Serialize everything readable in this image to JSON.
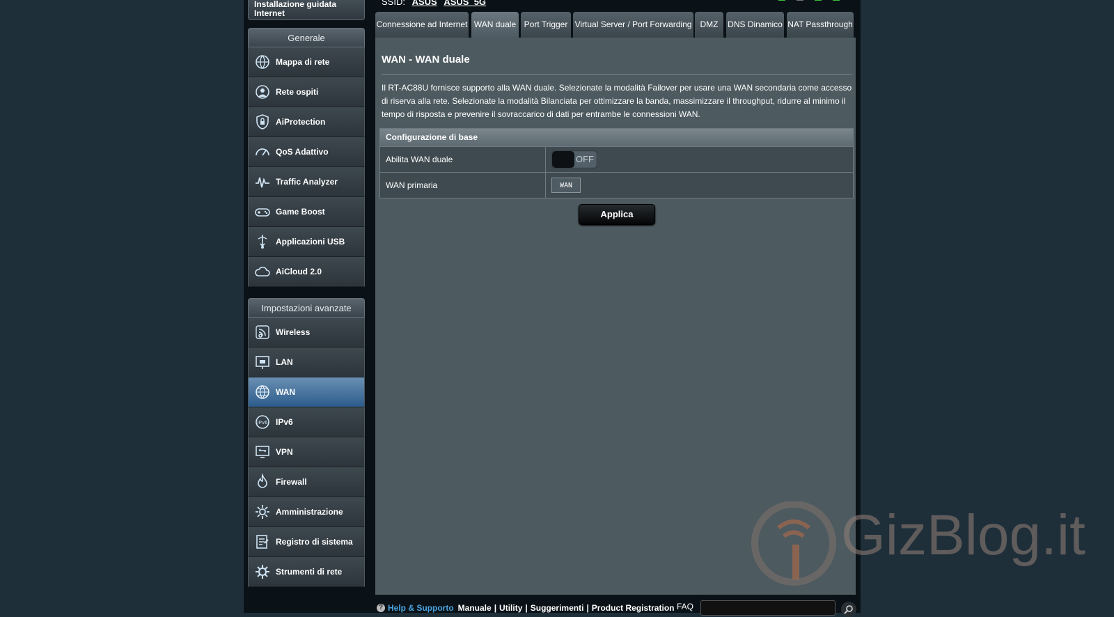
{
  "header": {
    "ssid_label": "SSID:",
    "ssid_1": "ASUS",
    "ssid_2": "ASUS_5G"
  },
  "sidebar": {
    "quick_setup": "Installazione guidata Internet",
    "general_title": "Generale",
    "general_items": [
      {
        "label": "Mappa di rete",
        "icon": "network-map-icon"
      },
      {
        "label": "Rete ospiti",
        "icon": "guest-network-icon"
      },
      {
        "label": "AiProtection",
        "icon": "shield-lock-icon"
      },
      {
        "label": "QoS Adattivo",
        "icon": "gauge-icon"
      },
      {
        "label": "Traffic Analyzer",
        "icon": "traffic-graph-icon"
      },
      {
        "label": "Game Boost",
        "icon": "gamepad-icon"
      },
      {
        "label": "Applicazioni USB",
        "icon": "usb-icon"
      },
      {
        "label": "AiCloud 2.0",
        "icon": "cloud-icon"
      }
    ],
    "advanced_title": "Impostazioni avanzate",
    "advanced_items": [
      {
        "label": "Wireless",
        "icon": "wireless-icon"
      },
      {
        "label": "LAN",
        "icon": "lan-icon"
      },
      {
        "label": "WAN",
        "icon": "globe-icon",
        "active": true
      },
      {
        "label": "IPv6",
        "icon": "ipv6-icon"
      },
      {
        "label": "VPN",
        "icon": "vpn-icon"
      },
      {
        "label": "Firewall",
        "icon": "fire-icon"
      },
      {
        "label": "Amministrazione",
        "icon": "admin-gear-icon"
      },
      {
        "label": "Registro di sistema",
        "icon": "log-icon"
      },
      {
        "label": "Strumenti di rete",
        "icon": "tools-gear-icon"
      }
    ]
  },
  "tabs": [
    {
      "label": "Connessione ad Internet"
    },
    {
      "label": "WAN duale",
      "active": true
    },
    {
      "label": "Port Trigger"
    },
    {
      "label": "Virtual Server / Port Forwarding"
    },
    {
      "label": "DMZ"
    },
    {
      "label": "DNS Dinamico"
    },
    {
      "label": "NAT Passthrough"
    }
  ],
  "main": {
    "title": "WAN - WAN duale",
    "description": "Il RT-AC88U fornisce supporto alla WAN duale. Selezionate la modalità Failover per usare una WAN secondaria come accesso di riserva alla rete. Selezionate la modalità Bilanciata per ottimizzare la banda, massimizzare il throughput, ridurre al minimo il tempo di risposta e prevenire il sovraccarico di dati per entrambe le connessioni WAN.",
    "config": {
      "header": "Configurazione di base",
      "enable_label": "Abilita WAN duale",
      "enable_state": "OFF",
      "primary_label": "WAN primaria",
      "primary_value": "WAN"
    },
    "apply_label": "Applica"
  },
  "footer": {
    "help": "Help & Supporto",
    "links": [
      "Manuale",
      "|",
      "Utility",
      "|",
      "Suggerimenti",
      "|",
      "Product Registration"
    ],
    "faq": "FAQ"
  },
  "watermark": "GizBlog.it",
  "colors": {
    "background": "#1f2f3a",
    "panel": "#4d5a60",
    "active_item": "#2c5c8c",
    "help_link": "#4aa3df"
  }
}
